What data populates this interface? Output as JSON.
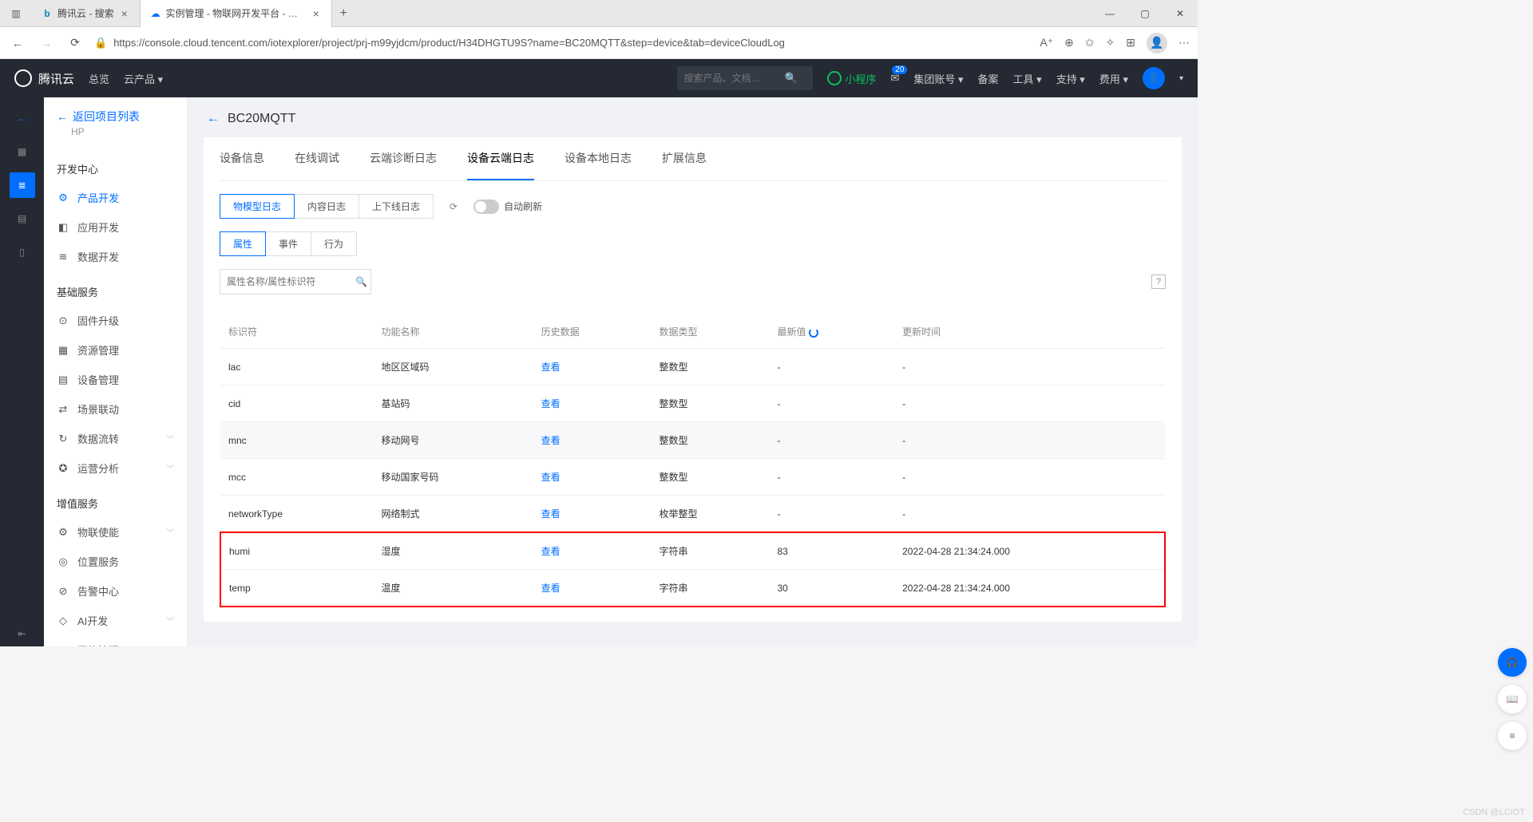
{
  "browser": {
    "tabs": [
      {
        "title": "腾讯云 - 搜索",
        "favicon": "b"
      },
      {
        "title": "实例管理 - 物联网开发平台 - 控…",
        "favicon": "☁"
      }
    ],
    "url": "https://console.cloud.tencent.com/iotexplorer/project/prj-m99yjdcm/product/H34DHGTU9S?name=BC20MQTT&step=device&tab=deviceCloudLog"
  },
  "cloudTop": {
    "brand": "腾讯云",
    "nav": [
      "总览",
      "云产品 ▾"
    ],
    "search_placeholder": "搜索产品、文档…",
    "miniProgram": "小程序",
    "mailBadge": "20",
    "rightMenu": [
      "集团账号 ▾",
      "备案",
      "工具 ▾",
      "支持 ▾",
      "费用 ▾"
    ]
  },
  "sidebar": {
    "back": "返回项目列表",
    "back_sub": "HP",
    "sections": [
      {
        "title": "开发中心",
        "items": [
          {
            "icon": "⚙",
            "label": "产品开发",
            "active": true
          },
          {
            "icon": "◧",
            "label": "应用开发"
          },
          {
            "icon": "≋",
            "label": "数据开发"
          }
        ]
      },
      {
        "title": "基础服务",
        "items": [
          {
            "icon": "⊙",
            "label": "固件升级"
          },
          {
            "icon": "▦",
            "label": "资源管理"
          },
          {
            "icon": "▤",
            "label": "设备管理"
          },
          {
            "icon": "⇄",
            "label": "场景联动"
          },
          {
            "icon": "↻",
            "label": "数据流转",
            "chev": true
          },
          {
            "icon": "✪",
            "label": "运营分析",
            "chev": true
          }
        ]
      },
      {
        "title": "增值服务",
        "items": [
          {
            "icon": "⚙",
            "label": "物联使能",
            "chev": true
          },
          {
            "icon": "◎",
            "label": "位置服务"
          },
          {
            "icon": "⊘",
            "label": "告警中心"
          },
          {
            "icon": "◇",
            "label": "AI开发",
            "chev": true
          },
          {
            "icon": "▨",
            "label": "网络管理"
          }
        ]
      }
    ]
  },
  "page": {
    "title": "BC20MQTT",
    "tabs": [
      "设备信息",
      "在线调试",
      "云端诊断日志",
      "设备云端日志",
      "设备本地日志",
      "扩展信息"
    ],
    "activeTab": 3,
    "logTypes": [
      "物模型日志",
      "内容日志",
      "上下线日志"
    ],
    "activeLogType": 0,
    "autoRefresh": "自动刷新",
    "propTabs": [
      "属性",
      "事件",
      "行为"
    ],
    "activePropTab": 0,
    "searchPlaceholder": "属性名称/属性标识符",
    "columns": [
      "标识符",
      "功能名称",
      "历史数据",
      "数据类型",
      "最新值",
      "更新时间"
    ],
    "viewLabel": "查看",
    "rows": [
      {
        "id": "lac",
        "name": "地区区域码",
        "type": "整数型",
        "value": "-",
        "time": "-"
      },
      {
        "id": "cid",
        "name": "基站码",
        "type": "整数型",
        "value": "-",
        "time": "-"
      },
      {
        "id": "mnc",
        "name": "移动网号",
        "type": "整数型",
        "value": "-",
        "time": "-",
        "hover": true
      },
      {
        "id": "mcc",
        "name": "移动国家号码",
        "type": "整数型",
        "value": "-",
        "time": "-"
      },
      {
        "id": "networkType",
        "name": "网络制式",
        "type": "枚举整型",
        "value": "-",
        "time": "-"
      },
      {
        "id": "humi",
        "name": "湿度",
        "type": "字符串",
        "value": "83",
        "time": "2022-04-28 21:34:24.000",
        "hl": true
      },
      {
        "id": "temp",
        "name": "温度",
        "type": "字符串",
        "value": "30",
        "time": "2022-04-28 21:34:24.000",
        "hl": true
      }
    ]
  },
  "watermark": "CSDN @LCIOT"
}
